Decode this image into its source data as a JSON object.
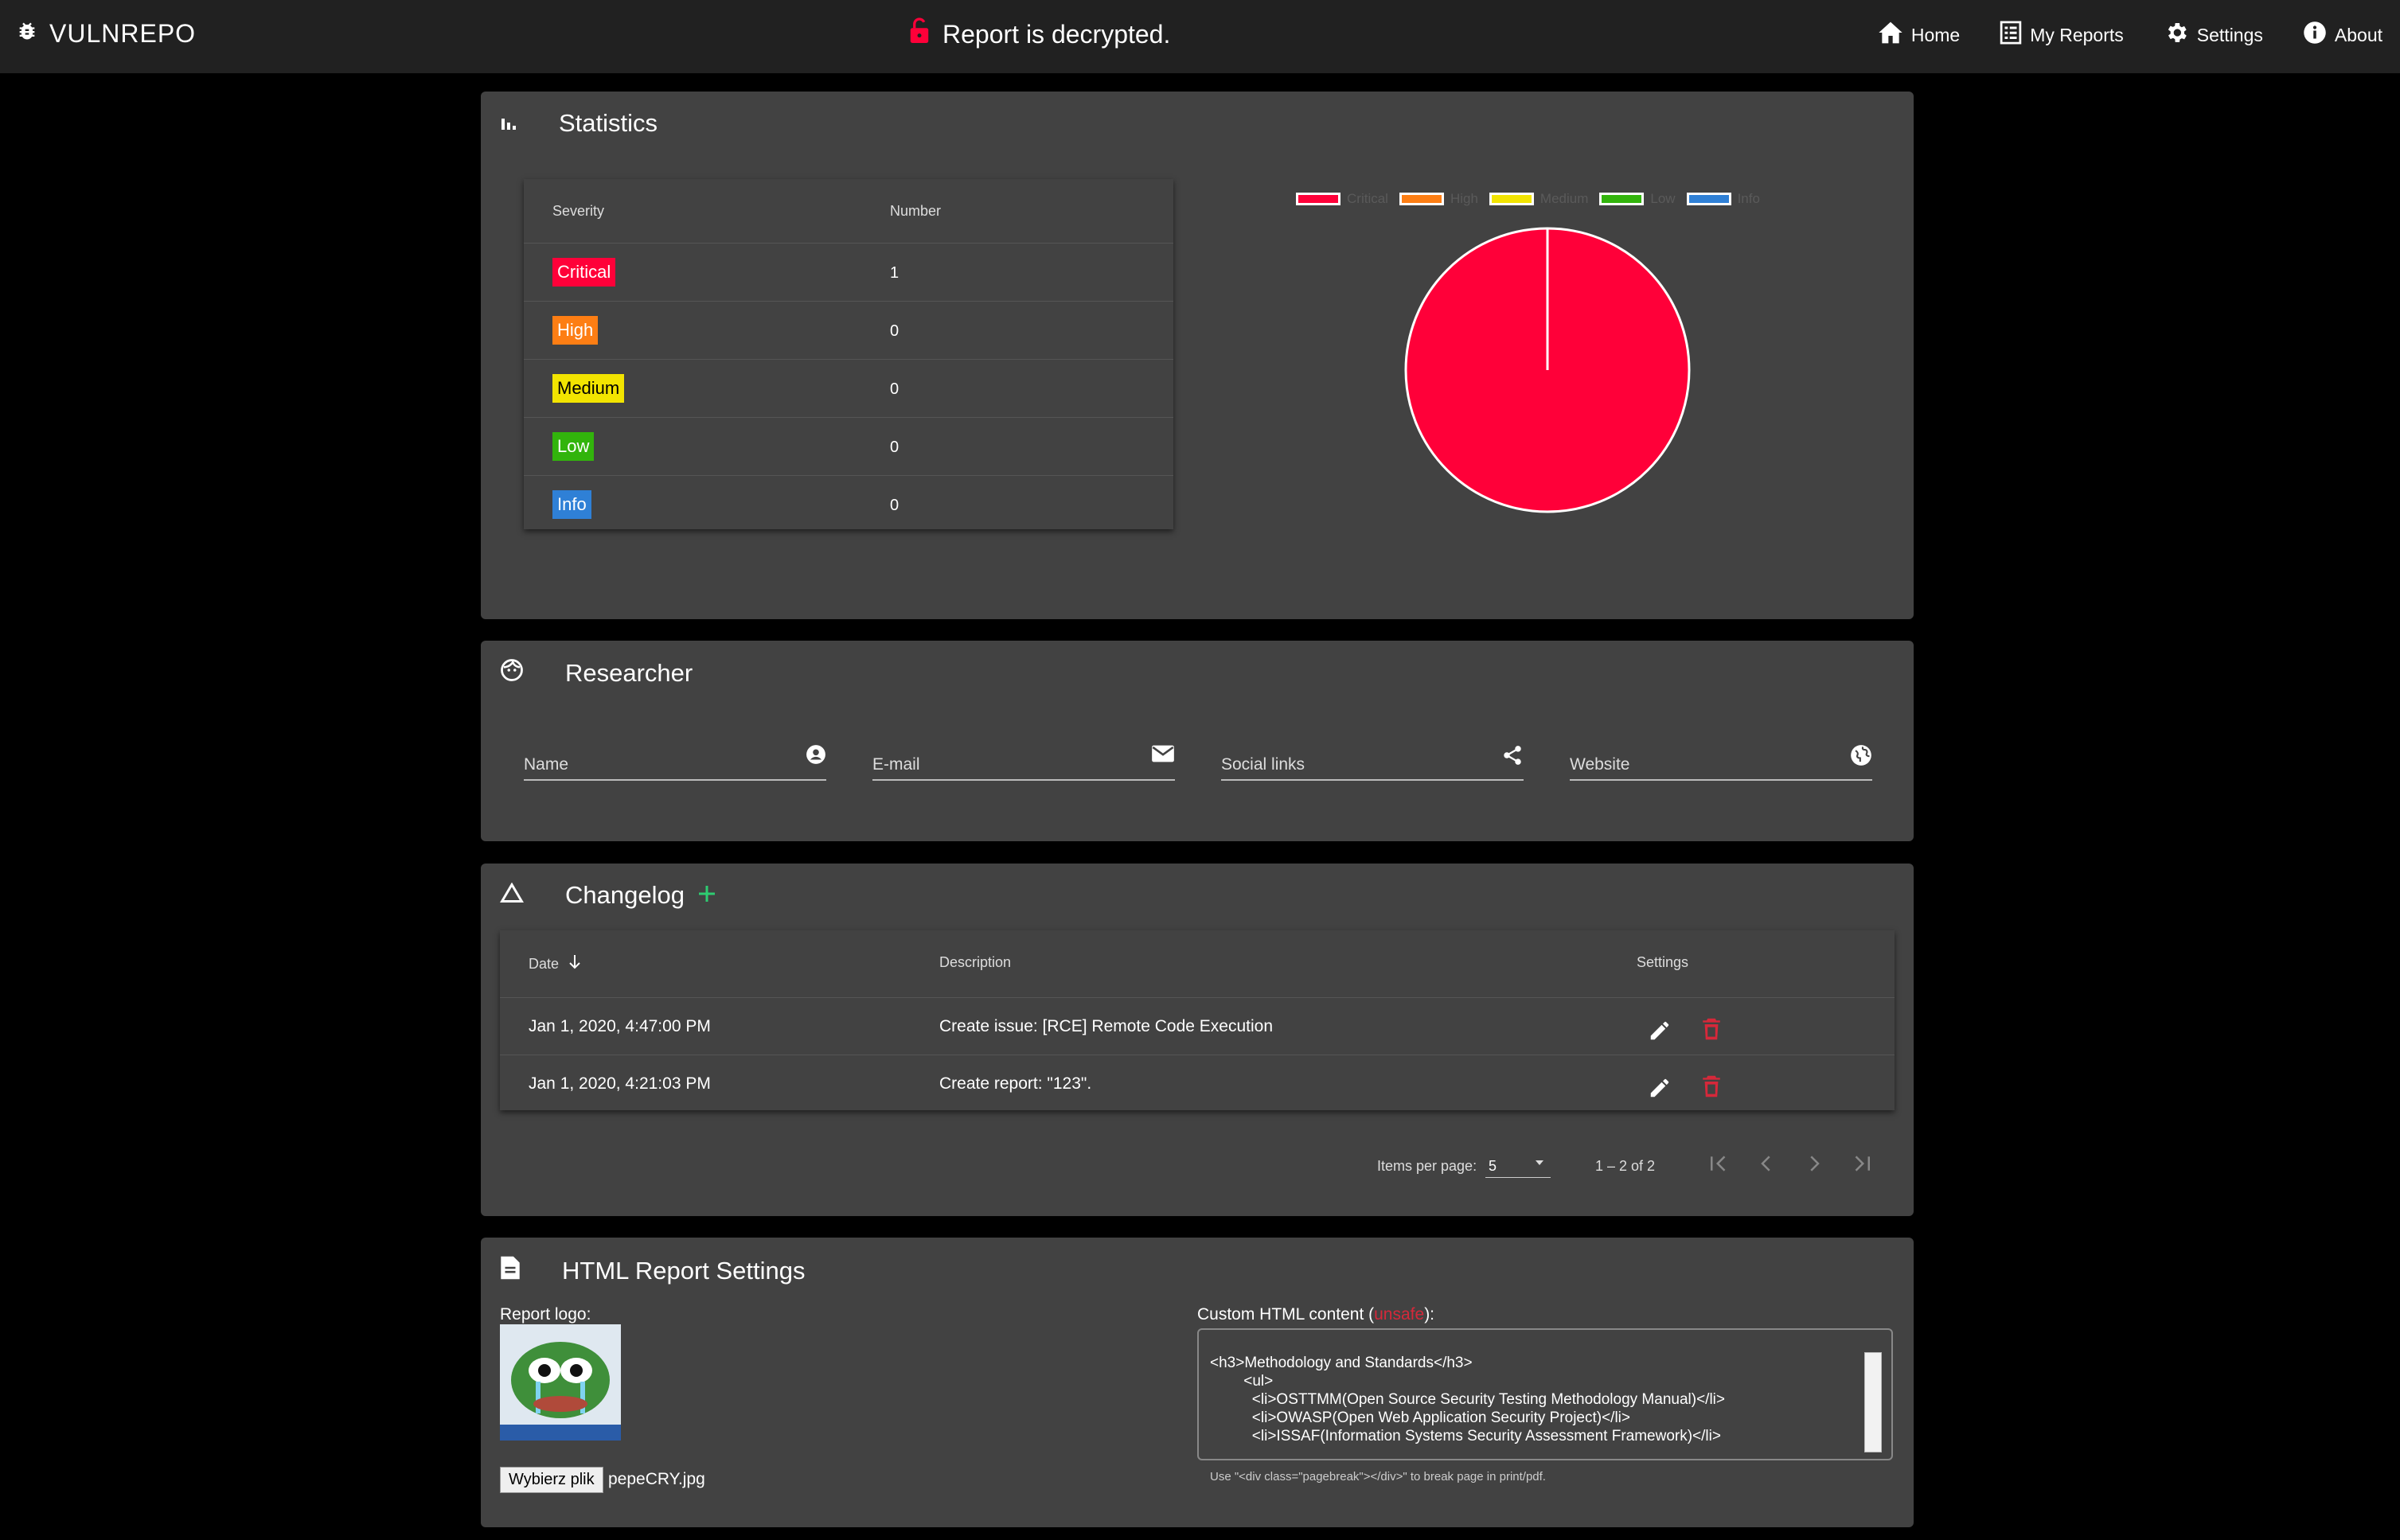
{
  "topbar": {
    "brand": "VULNREPO",
    "status": "Report is decrypted.",
    "nav": [
      {
        "label": "Home",
        "icon": "home-icon"
      },
      {
        "label": "My Reports",
        "icon": "list-icon"
      },
      {
        "label": "Settings",
        "icon": "gear-icon"
      },
      {
        "label": "About",
        "icon": "info-icon"
      }
    ]
  },
  "colors": {
    "critical": "#ff0039",
    "high": "#fd7e14",
    "medium": "#f2e400",
    "low": "#32b40c",
    "info": "#2f80d6",
    "accent_green": "#2ecc71",
    "danger": "#d6283a"
  },
  "statistics": {
    "title": "Statistics",
    "col_severity": "Severity",
    "col_number": "Number",
    "rows": [
      {
        "label": "Critical",
        "value": "1"
      },
      {
        "label": "High",
        "value": "0"
      },
      {
        "label": "Medium",
        "value": "0"
      },
      {
        "label": "Low",
        "value": "0"
      },
      {
        "label": "Info",
        "value": "0"
      }
    ]
  },
  "chart_data": {
    "type": "pie",
    "categories": [
      "Critical",
      "High",
      "Medium",
      "Low",
      "Info"
    ],
    "values": [
      1,
      0,
      0,
      0,
      0
    ],
    "colors": [
      "#ff0039",
      "#fd7e14",
      "#f2e400",
      "#32b40c",
      "#2f80d6"
    ],
    "legend": "top"
  },
  "researcher": {
    "title": "Researcher",
    "fields": [
      {
        "label": "Name",
        "icon": "account-icon"
      },
      {
        "label": "E-mail",
        "icon": "mail-icon"
      },
      {
        "label": "Social links",
        "icon": "share-icon"
      },
      {
        "label": "Website",
        "icon": "globe-icon"
      }
    ]
  },
  "changelog": {
    "title": "Changelog",
    "col_date": "Date",
    "col_description": "Description",
    "col_settings": "Settings",
    "rows": [
      {
        "date": "Jan 1, 2020, 4:47:00 PM",
        "description": "Create issue: [RCE] Remote Code Execution"
      },
      {
        "date": "Jan 1, 2020, 4:21:03 PM",
        "description": "Create report: \"123\"."
      }
    ],
    "paginator": {
      "items_label": "Items per page:",
      "page_size": "5",
      "range": "1 – 2 of 2"
    }
  },
  "html_settings": {
    "title": "HTML Report Settings",
    "logo_label": "Report logo:",
    "file_button": "Wybierz plik",
    "file_name": "pepeCRY.jpg",
    "custom_label_prefix": "Custom HTML content (",
    "custom_label_unsafe": "unsafe",
    "custom_label_suffix": "):",
    "custom_content": "<h3>Methodology and Standards</h3>\n        <ul>\n          <li>OSTTMM(Open Source Security Testing Methodology Manual)</li>\n          <li>OWASP(Open Web Application Security Project)</li>\n          <li>ISSAF(Information Systems Security Assessment Framework)</li>",
    "hint": "Use \"<div class=\"pagebreak\"></div>\" to break page in print/pdf."
  }
}
